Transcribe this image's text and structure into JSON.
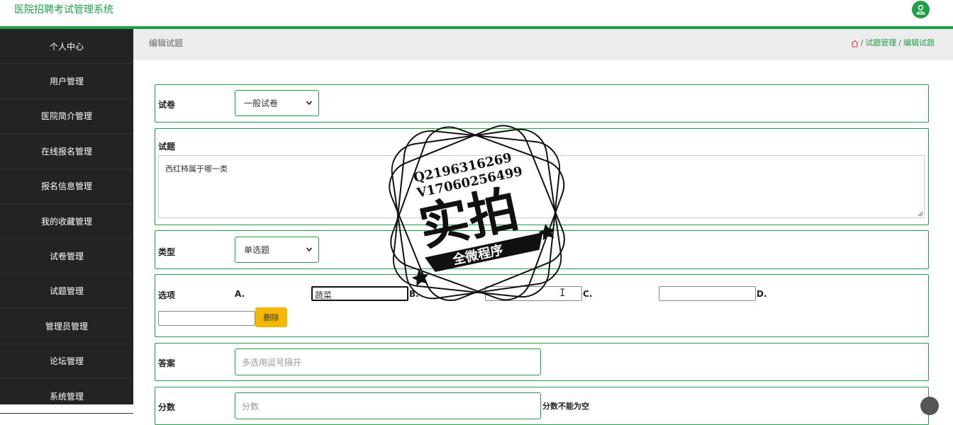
{
  "app": {
    "title": "医院招聘考试管理系统"
  },
  "header": {
    "avatar_icon": "user-icon"
  },
  "sidebar": {
    "items": [
      {
        "label": "个人中心"
      },
      {
        "label": "用户管理"
      },
      {
        "label": "医院简介管理"
      },
      {
        "label": "在线报名管理"
      },
      {
        "label": "报名信息管理"
      },
      {
        "label": "我的收藏管理"
      },
      {
        "label": "试卷管理"
      },
      {
        "label": "试题管理"
      },
      {
        "label": "管理员管理"
      },
      {
        "label": "论坛管理"
      },
      {
        "label": "系统管理"
      }
    ]
  },
  "page": {
    "title": "编辑试题",
    "breadcrumb": {
      "home_icon": "home-icon",
      "sep": "/",
      "level1": "试题管理",
      "level2": "编辑试题"
    }
  },
  "form": {
    "paper": {
      "label": "试卷",
      "value": "一般试卷"
    },
    "question": {
      "label": "试题",
      "value": "西红柿属于哪一类"
    },
    "type": {
      "label": "类型",
      "value": "单选题"
    },
    "options": {
      "label": "选项",
      "letters": [
        "A.",
        "B.",
        "C.",
        "D."
      ],
      "values": [
        "蔬菜",
        "",
        "",
        ""
      ],
      "delete_label": "删除"
    },
    "answer": {
      "label": "答案",
      "placeholder": "多选用逗号隔开"
    },
    "score": {
      "label": "分数",
      "placeholder": "分数",
      "note": "分数不能为空"
    }
  },
  "watermark": {
    "line1": "Q2196316269",
    "line2": "V17060256499",
    "main": "实拍",
    "banner": "全微程序"
  },
  "colors": {
    "accent": "#1f9d47",
    "sidebar_bg": "#232323",
    "button_warning": "#f5b800"
  }
}
